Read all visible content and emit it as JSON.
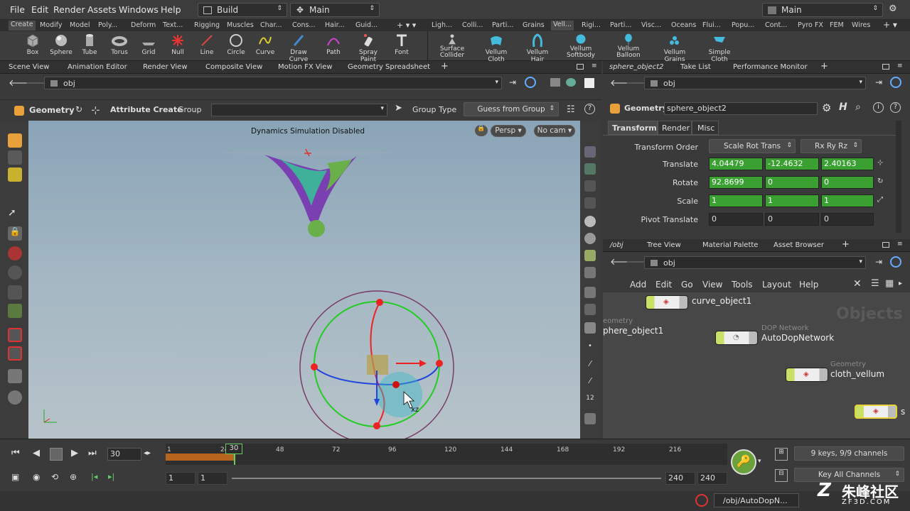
{
  "menu": [
    "File",
    "Edit",
    "Render",
    "Assets",
    "Windows",
    "Help"
  ],
  "desktop": {
    "build": "Build",
    "main": "Main",
    "main_right": "Main"
  },
  "shelf_tabs_left": [
    "Create",
    "Modify",
    "Model",
    "Poly...",
    "Deform",
    "Text...",
    "Rigging",
    "Muscles",
    "Char...",
    "Cons...",
    "Hair...",
    "Guid..."
  ],
  "shelf_tabs_right": [
    "Ligh...",
    "Colli...",
    "Parti...",
    "Grains",
    "Vell...",
    "Rigi...",
    "Parti...",
    "Visc...",
    "Oceans",
    "Flui...",
    "Popu...",
    "Cont...",
    "Pyro FX",
    "FEM",
    "Wires"
  ],
  "tools_left": [
    "Box",
    "Sphere",
    "Tube",
    "Torus",
    "Grid",
    "Null",
    "Line",
    "Circle",
    "Curve",
    "Draw Curve",
    "Path",
    "Spray Paint",
    "Font"
  ],
  "tools_right": [
    {
      "l1": "Surface",
      "l2": "Collider"
    },
    {
      "l1": "Vellum Cloth",
      "l2": ""
    },
    {
      "l1": "Vellum Hair",
      "l2": ""
    },
    {
      "l1": "Vellum",
      "l2": "Softbody"
    },
    {
      "l1": "Vellum",
      "l2": "Balloon"
    },
    {
      "l1": "Vellum Grains",
      "l2": ""
    },
    {
      "l1": "Simple Cloth",
      "l2": ""
    }
  ],
  "pane_tabs_left": [
    "Scene View",
    "Animation Editor",
    "Render View",
    "Composite View",
    "Motion FX View",
    "Geometry Spreadsheet"
  ],
  "pane_tabs_right": [
    "sphere_object2",
    "Take List",
    "Performance Monitor"
  ],
  "path": {
    "left": "obj",
    "right": "obj",
    "net": "obj"
  },
  "op_toolbar": {
    "context": "Geometry",
    "tool": "Attribute Create",
    "group_label": "Group",
    "group_type_label": "Group Type",
    "group_type_value": "Guess from Group"
  },
  "viewport": {
    "status": "Dynamics Simulation Disabled",
    "persp": "Persp",
    "cam": "No cam",
    "handle_label": "xz"
  },
  "params": {
    "node_type": "Geometry",
    "node_name": "sphere_object2",
    "tabs": [
      "Transform",
      "Render",
      "Misc"
    ],
    "transform_order_label": "Transform Order",
    "transform_order": "Scale Rot Trans",
    "rot_order": "Rx Ry Rz",
    "translate_label": "Translate",
    "translate": [
      "4.04479",
      "-12.4632",
      "2.40163"
    ],
    "rotate_label": "Rotate",
    "rotate": [
      "92.8699",
      "0",
      "0"
    ],
    "scale_label": "Scale",
    "scale": [
      "1",
      "1",
      "1"
    ],
    "pivot_label": "Pivot Translate",
    "pivot": [
      "0",
      "0",
      "0"
    ]
  },
  "net_tabs": [
    "/obj",
    "Tree View",
    "Material Palette",
    "Asset Browser"
  ],
  "net_menu": [
    "Add",
    "Edit",
    "Go",
    "View",
    "Tools",
    "Layout",
    "Help"
  ],
  "net": {
    "watermark": "Objects",
    "nodes": [
      {
        "name": "curve_object1",
        "type": ""
      },
      {
        "name": "phere_object1",
        "type": "eometry"
      },
      {
        "name": "AutoDopNetwork",
        "type": "DOP Network"
      },
      {
        "name": "cloth_vellum",
        "type": "Geometry"
      }
    ],
    "edge_s": "s"
  },
  "timeline": {
    "ticks": [
      "1",
      "24",
      "48",
      "72",
      "96",
      "120",
      "144",
      "168",
      "192",
      "216"
    ],
    "current_frame": "30",
    "frame_field": "30",
    "range_start": "1",
    "range_start2": "1",
    "range_end": "240",
    "range_end2": "240",
    "keys": "9 keys, 9/9 channels",
    "key_all": "Key All Channels"
  },
  "status": {
    "path": "/obj/AutoDopN..."
  },
  "brand": {
    "cn": "朱峰社区",
    "url": "ZF3D.COM"
  },
  "colors": {
    "accent": "#e8a13a",
    "green_field": "#3aa032",
    "node_selected": "#e8d23a"
  }
}
